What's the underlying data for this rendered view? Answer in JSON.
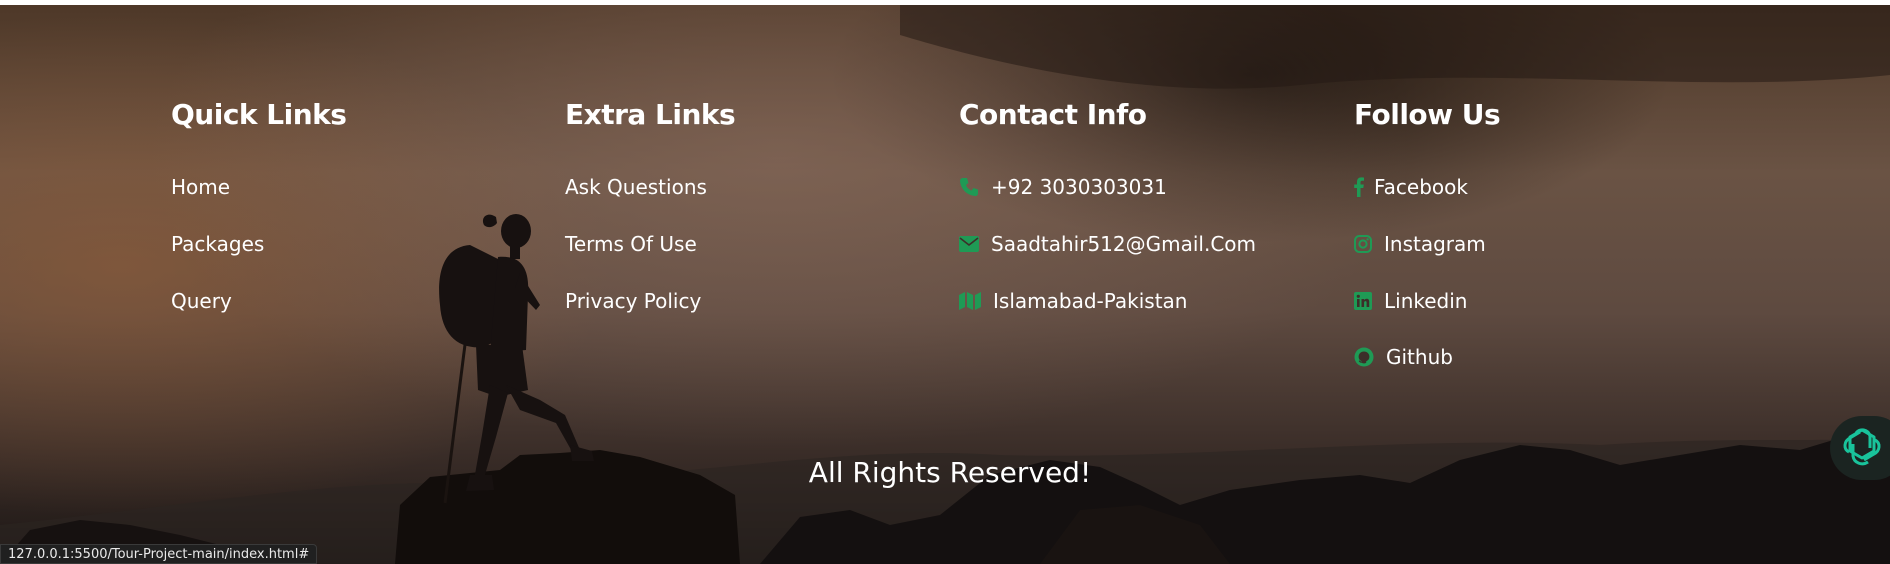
{
  "colors": {
    "accent": "#1f9a55",
    "text": "#ffffff"
  },
  "columns": [
    {
      "title": "Quick Links",
      "links": [
        {
          "label": "Home"
        },
        {
          "label": "Packages"
        },
        {
          "label": "Query"
        }
      ]
    },
    {
      "title": "Extra Links",
      "links": [
        {
          "label": "Ask Questions"
        },
        {
          "label": "Terms Of Use"
        },
        {
          "label": "Privacy Policy"
        }
      ]
    },
    {
      "title": "Contact Info",
      "links": [
        {
          "label": "+92 3030303031",
          "icon": "phone-icon"
        },
        {
          "label": "Saadtahir512@Gmail.Com",
          "icon": "envelope-icon"
        },
        {
          "label": "Islamabad-Pakistan",
          "icon": "map-icon"
        }
      ]
    },
    {
      "title": "Follow Us",
      "links": [
        {
          "label": "Facebook",
          "icon": "facebook-icon"
        },
        {
          "label": "Instagram",
          "icon": "instagram-icon"
        },
        {
          "label": "Linkedin",
          "icon": "linkedin-icon"
        },
        {
          "label": "Github",
          "icon": "github-icon"
        }
      ]
    }
  ],
  "copyright": "All Rights Reserved!",
  "status_url": "127.0.0.1:5500/Tour-Project-main/index.html#",
  "assistant_icon": "openai-assistant-icon"
}
